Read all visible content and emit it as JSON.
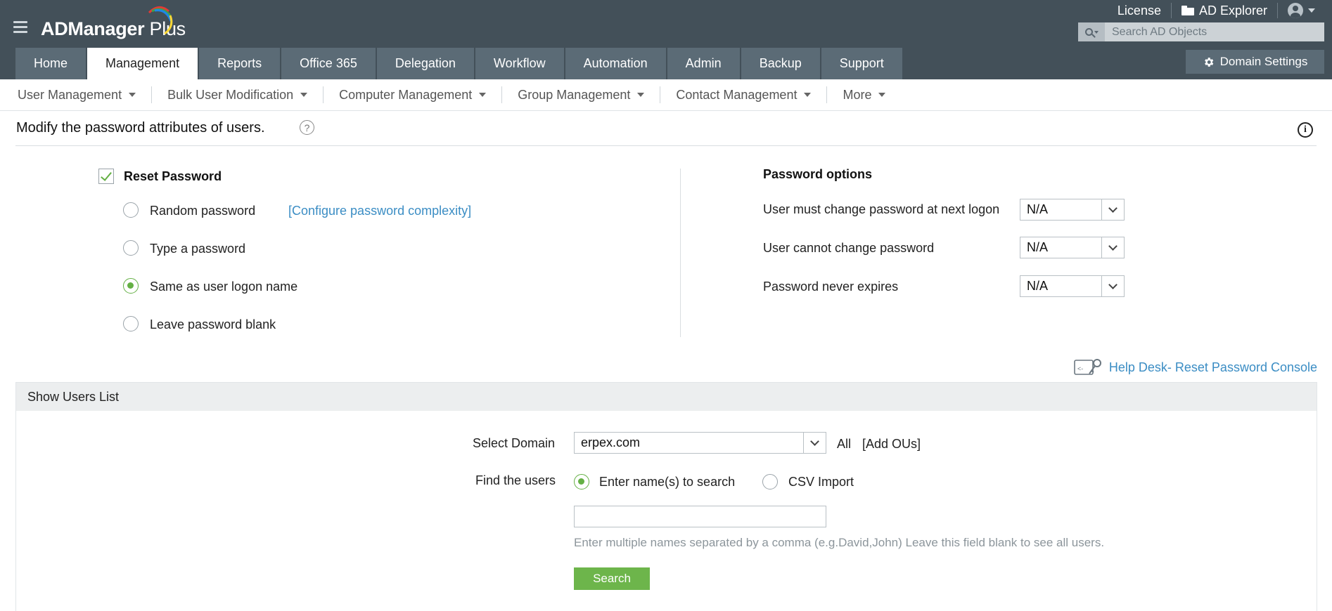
{
  "app": {
    "logo_text_bold": "ADManager",
    "logo_text_light": " Plus"
  },
  "header_links": {
    "license": "License",
    "ad_explorer": "AD Explorer"
  },
  "search": {
    "placeholder": "Search AD Objects"
  },
  "tabs": [
    {
      "label": "Home"
    },
    {
      "label": "Management"
    },
    {
      "label": "Reports"
    },
    {
      "label": "Office 365"
    },
    {
      "label": "Delegation"
    },
    {
      "label": "Workflow"
    },
    {
      "label": "Automation"
    },
    {
      "label": "Admin"
    },
    {
      "label": "Backup"
    },
    {
      "label": "Support"
    }
  ],
  "active_tab": "Management",
  "domain_settings_label": "Domain Settings",
  "submenu": [
    {
      "label": "User Management"
    },
    {
      "label": "Bulk User Modification"
    },
    {
      "label": "Computer Management"
    },
    {
      "label": "Group Management"
    },
    {
      "label": "Contact Management"
    },
    {
      "label": "More"
    }
  ],
  "page": {
    "title": "Modify the password attributes of users.",
    "help_glyph": "?",
    "info_glyph": "i"
  },
  "reset_password": {
    "label": "Reset Password",
    "checked": true,
    "options": [
      {
        "label": "Random password",
        "selected": false
      },
      {
        "label": "Type a password",
        "selected": false
      },
      {
        "label": "Same as user logon name",
        "selected": true
      },
      {
        "label": "Leave password blank",
        "selected": false
      }
    ],
    "configure_link": "[Configure password complexity]"
  },
  "password_options": {
    "title": "Password options",
    "rows": [
      {
        "label": "User must change password at next logon",
        "value": "N/A"
      },
      {
        "label": "User cannot change password",
        "value": "N/A"
      },
      {
        "label": "Password never expires",
        "value": "N/A"
      }
    ]
  },
  "helpdesk_link": "Help Desk- Reset Password Console",
  "users_list": {
    "heading": "Show Users List",
    "select_domain_label": "Select Domain",
    "domain_value": "erpex.com",
    "all_label": "All",
    "add_ous_link": "[Add OUs]",
    "find_users_label": "Find the users",
    "find_options": [
      {
        "label": "Enter name(s) to search",
        "selected": true
      },
      {
        "label": "CSV Import",
        "selected": false
      }
    ],
    "names_value": "",
    "hint": "Enter multiple names separated by a comma (e.g.David,John) Leave this field blank to see all users.",
    "search_button": "Search"
  },
  "colors": {
    "header_bg": "#435059",
    "tab_bg": "#5b6b76",
    "accent_green": "#6db54b",
    "link_blue": "#3b8dc4"
  }
}
